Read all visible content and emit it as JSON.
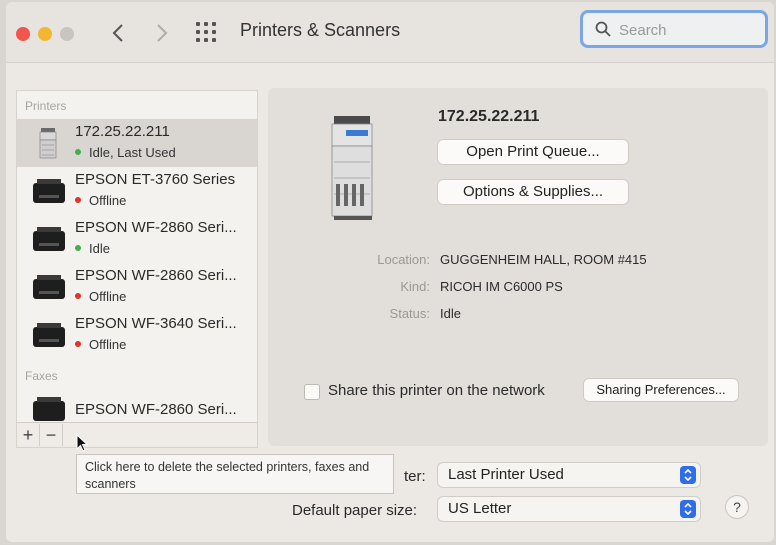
{
  "window": {
    "title": "Printers & Scanners",
    "search": {
      "placeholder": "Search",
      "value": ""
    }
  },
  "sidebar": {
    "printers_label": "Printers",
    "faxes_label": "Faxes",
    "printers": [
      {
        "name": "172.25.22.211",
        "status": "Idle, Last Used",
        "status_color": "#3fb14a",
        "selected": true,
        "icon": "copier-printer-icon"
      },
      {
        "name": "EPSON ET-3760 Series",
        "status": "Offline",
        "status_color": "#e0342a",
        "selected": false,
        "icon": "inkjet-printer-icon"
      },
      {
        "name": "EPSON WF-2860 Seri...",
        "status": "Idle",
        "status_color": "#3fb14a",
        "selected": false,
        "icon": "inkjet-printer-icon"
      },
      {
        "name": "EPSON WF-2860 Seri...",
        "status": "Offline",
        "status_color": "#e0342a",
        "selected": false,
        "icon": "inkjet-printer-icon"
      },
      {
        "name": "EPSON WF-3640 Seri...",
        "status": "Offline",
        "status_color": "#e0342a",
        "selected": false,
        "icon": "inkjet-printer-icon"
      }
    ],
    "faxes": [
      {
        "name": "EPSON WF-2860 Seri...",
        "icon": "fax-printer-icon"
      }
    ],
    "add_label": "+",
    "remove_label": "−"
  },
  "detail": {
    "printer_name": "172.25.22.211",
    "open_queue_label": "Open Print Queue...",
    "options_label": "Options & Supplies...",
    "location_label": "Location:",
    "location_value": "GUGGENHEIM HALL, ROOM #415",
    "kind_label": "Kind:",
    "kind_value": "RICOH IM C6000 PS",
    "status_label": "Status:",
    "status_value": "Idle",
    "share_label": "Share this printer on the network",
    "share_checked": false,
    "sharing_prefs_label": "Sharing Preferences..."
  },
  "settings": {
    "default_printer_label": "ter:",
    "default_printer_value": "Last Printer Used",
    "paper_size_label": "Default paper size:",
    "paper_size_value": "US Letter",
    "help_label": "?"
  },
  "tooltip": {
    "text": "Click here to delete the selected printers, faxes and scanners"
  },
  "colors": {
    "accent": "#2f6ee6",
    "status_green": "#3fb14a",
    "status_red": "#e0342a"
  }
}
